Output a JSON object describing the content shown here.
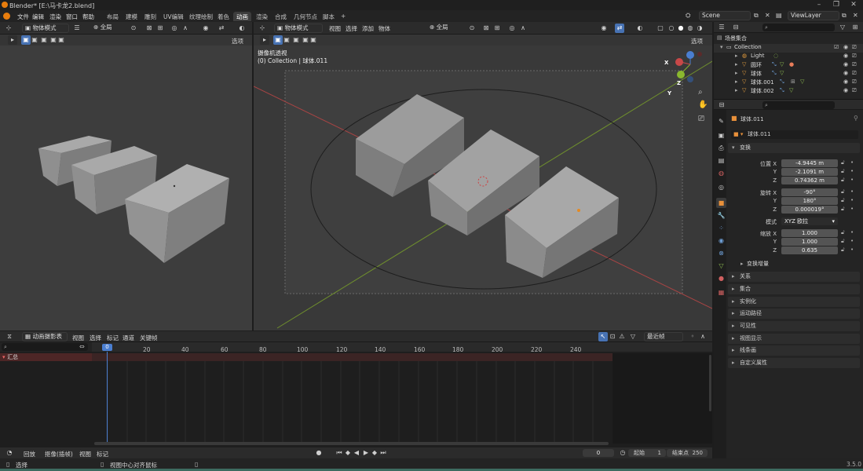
{
  "titlebar": {
    "title": "Blender* [E:\\马卡龙2.blend]"
  },
  "menu": [
    "文件",
    "编辑",
    "渲染",
    "窗口",
    "帮助"
  ],
  "workspaces": [
    "布局",
    "建模",
    "雕刻",
    "UV编辑",
    "纹理绘制",
    "着色",
    "动画",
    "渲染",
    "合成",
    "几何节点",
    "脚本"
  ],
  "active_workspace": "动画",
  "add_workspace": "+",
  "scene": "Scene",
  "view_layer": "ViewLayer",
  "left_view": {
    "mode": "物体模式",
    "orient": "全局",
    "options": "选项"
  },
  "main_view": {
    "mode": "物体模式",
    "menus": [
      "视图",
      "选择",
      "添加",
      "物体"
    ],
    "orient": "全局",
    "options": "选项",
    "cam_title": "摄像机透视",
    "cam_sub": "(0) Collection | 球体.011",
    "gizmo": {
      "x": "X",
      "y": "Y",
      "z": "Z"
    }
  },
  "outliner": {
    "root": "场景集合",
    "collection": "Collection",
    "items": [
      "Light",
      "圆环",
      "球体",
      "球体.001",
      "球体.002"
    ]
  },
  "props": {
    "object_name": "球体.011",
    "object_field": "球体.011",
    "section": "变换",
    "location_label": "位置 X",
    "location": [
      "-4.9445 m",
      "-2.1091 m",
      "0.74362 m"
    ],
    "rotation_label": "旋转 X",
    "rotation": [
      "-90°",
      "180°",
      "0.000019°"
    ],
    "axis_y": "Y",
    "axis_z": "Z",
    "mode_label": "模式",
    "mode_value": "XYZ 欧拉",
    "scale_label": "缩放 X",
    "scale": [
      "1.000",
      "1.000",
      "0.635"
    ],
    "delta": "变换增量",
    "panels": [
      "关系",
      "集合",
      "实例化",
      "运动路径",
      "可见性",
      "视图显示",
      "线条画",
      "自定义属性"
    ]
  },
  "timeline": {
    "editor": "动画摄影表",
    "menus": [
      "视图",
      "选择",
      "标记",
      "通道",
      "关键帧"
    ],
    "snap": "最近帧",
    "current_frame_tag": "0",
    "ticks": [
      "20",
      "40",
      "60",
      "80",
      "100",
      "120",
      "140",
      "160",
      "180",
      "200",
      "220",
      "240"
    ],
    "summary": "汇总"
  },
  "playback": {
    "menus": [
      "回放",
      "抠像(插帧)",
      "视图",
      "标记"
    ],
    "frame": "0",
    "start_label": "起始",
    "start": "1",
    "end_label": "结束点",
    "end": "250"
  },
  "status": {
    "select": "选择",
    "center": "视图中心对齐鼠标",
    "version": "3.5.0"
  }
}
